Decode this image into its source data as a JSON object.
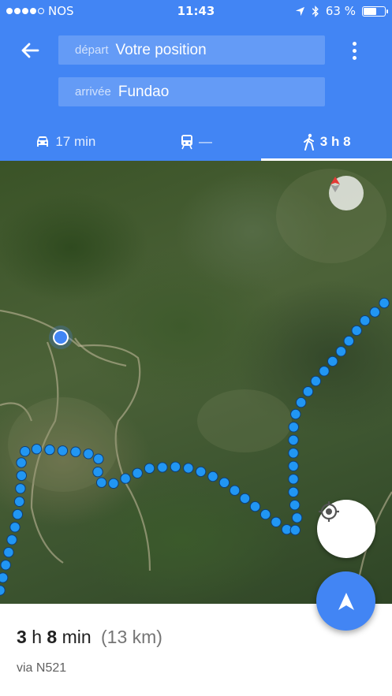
{
  "status_bar": {
    "carrier": "NOS",
    "time": "11:43",
    "battery_percent": "63 %",
    "battery_level": 0.63
  },
  "header": {
    "start_label": "départ",
    "start_value": "Votre position",
    "end_label": "arrivée",
    "end_value": "Fundao"
  },
  "tabs": [
    {
      "icon": "car-icon",
      "label": "17 min"
    },
    {
      "icon": "train-icon",
      "label": "—"
    },
    {
      "icon": "walk-icon",
      "label": "3 h 8",
      "active": true
    }
  ],
  "route": {
    "duration_hours": "3",
    "duration_h_unit": "h",
    "duration_minutes": "8",
    "duration_min_unit": "min",
    "distance": "(13 km)",
    "via": "via N521"
  },
  "colors": {
    "primary": "#4285F4",
    "route": "#2196F3"
  }
}
